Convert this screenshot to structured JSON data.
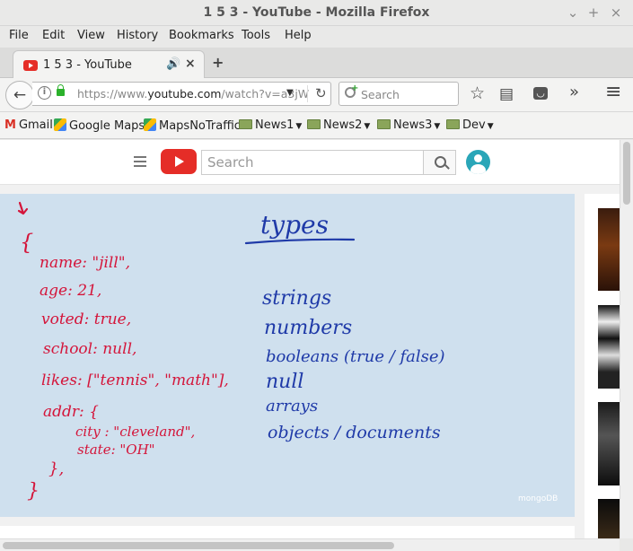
{
  "window": {
    "title": "1 5 3 - YouTube - Mozilla Firefox",
    "minimize": "⌄",
    "maximize": "+",
    "close": "×"
  },
  "menu": [
    "File",
    "Edit",
    "View",
    "History",
    "Bookmarks",
    "Tools",
    "Help"
  ],
  "menu_hotkeys": [
    "F",
    "E",
    "V",
    "H",
    "B",
    "T",
    "H"
  ],
  "tab": {
    "title": "1 5 3 - YouTube",
    "audio_icon": "🔊",
    "close": "×",
    "new_tab": "+"
  },
  "navbar": {
    "back": "←",
    "url_grey": "https://www.",
    "url_domain": "youtube.com",
    "url_rest": "/watch?v=a3jW",
    "dropdown": "▼",
    "reload": "↻",
    "search_placeholder": "Search",
    "star": "☆",
    "reader": "▤",
    "pocket": "◡",
    "overflow": "»",
    "menu": "≡"
  },
  "bookmarks": [
    {
      "label": "Gmail",
      "icon": "gmail-icon"
    },
    {
      "label": "Google Maps",
      "icon": "maps-icon"
    },
    {
      "label": "MapsNoTraffic",
      "icon": "maps-icon"
    },
    {
      "label": "News1",
      "icon": "folder-icon",
      "caret": "▼"
    },
    {
      "label": "News2",
      "icon": "folder-icon",
      "caret": "▼"
    },
    {
      "label": "News3",
      "icon": "folder-icon",
      "caret": "▼"
    },
    {
      "label": "Dev",
      "icon": "folder-icon",
      "caret": "▼"
    }
  ],
  "youtube": {
    "search_placeholder": "Search"
  },
  "video": {
    "heading": "types",
    "json_lines": [
      "{",
      "name: \"jill\",",
      "age: 21,",
      "voted: true,",
      "school: null,",
      "likes: [\"tennis\", \"math\"],",
      "addr: {",
      "city : \"cleveland\",",
      "state: \"OH\"",
      "},",
      "}"
    ],
    "types_list": [
      "strings",
      "numbers",
      "booleans (true / false)",
      "null",
      "arrays",
      "objects / documents"
    ],
    "watermark": "mongoDB"
  },
  "colors": {
    "red_ink": "#d4153a",
    "blue_ink": "#1f3aa8",
    "board": "#cfe0ee",
    "youtube_red": "#e52d27"
  }
}
